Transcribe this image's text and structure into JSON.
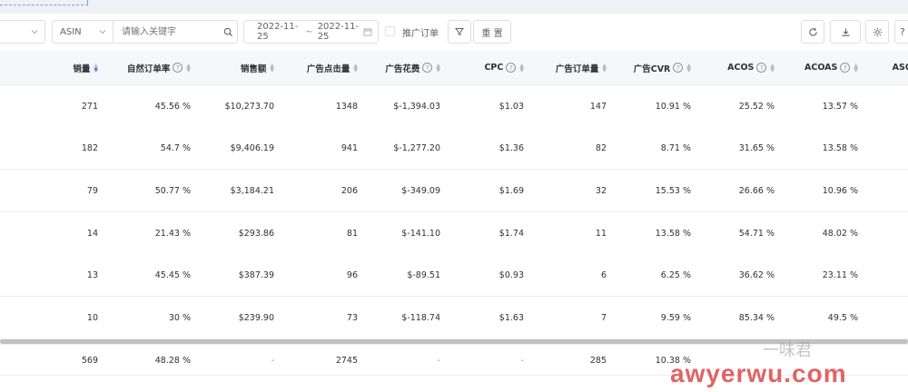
{
  "toolbar": {
    "asin_select": "ASIN",
    "keyword_placeholder": "请输入关键字",
    "date_start": "2022-11-25",
    "date_sep": "~",
    "date_end": "2022-11-25",
    "ad_order_label": "推广订单",
    "reset_label": "重 置"
  },
  "columns": [
    {
      "label": "销量",
      "help": false,
      "sort": "desc"
    },
    {
      "label": "自然订单率",
      "help": true,
      "sort": "none"
    },
    {
      "label": "销售额",
      "help": false,
      "sort": "none"
    },
    {
      "label": "广告点击量",
      "help": false,
      "sort": "none"
    },
    {
      "label": "广告花费",
      "help": true,
      "sort": "none"
    },
    {
      "label": "CPC",
      "help": true,
      "sort": "none"
    },
    {
      "label": "广告订单量",
      "help": false,
      "sort": "none"
    },
    {
      "label": "广告CVR",
      "help": true,
      "sort": "none"
    },
    {
      "label": "ACOS",
      "help": true,
      "sort": "none"
    },
    {
      "label": "ACOAS",
      "help": true,
      "sort": "none"
    },
    {
      "label": "ASOA",
      "help": false,
      "sort": "none"
    }
  ],
  "rows": [
    [
      "271",
      "45.56 %",
      "$10,273.70",
      "1348",
      "$-1,394.03",
      "$1.03",
      "147",
      "10.91 %",
      "25.52 %",
      "13.57 %"
    ],
    [
      "182",
      "54.7 %",
      "$9,406.19",
      "941",
      "$-1,277.20",
      "$1.36",
      "82",
      "8.71 %",
      "31.65 %",
      "13.58 %"
    ],
    [
      "79",
      "50.77 %",
      "$3,184.21",
      "206",
      "$-349.09",
      "$1.69",
      "32",
      "15.53 %",
      "26.66 %",
      "10.96 %"
    ],
    [
      "14",
      "21.43 %",
      "$293.86",
      "81",
      "$-141.10",
      "$1.74",
      "11",
      "13.58 %",
      "54.71 %",
      "48.02 %"
    ],
    [
      "13",
      "45.45 %",
      "$387.39",
      "96",
      "$-89.51",
      "$0.93",
      "6",
      "6.25 %",
      "36.62 %",
      "23.11 %"
    ],
    [
      "10",
      "30 %",
      "$239.90",
      "73",
      "$-118.74",
      "$1.63",
      "7",
      "9.59 %",
      "85.34 %",
      "49.5 %"
    ]
  ],
  "total_row": [
    "569",
    "48.28 %",
    "-",
    "2745",
    "-",
    "-",
    "285",
    "10.38 %",
    "",
    ""
  ],
  "watermark": {
    "brand": "一味君",
    "url": "awyerwu.com"
  },
  "icons": {
    "refresh": "refresh-icon",
    "download": "download-icon",
    "settings": "gear-icon",
    "help": "help-icon",
    "search": "search-icon",
    "calendar": "calendar-icon",
    "filter": "filter-icon"
  }
}
